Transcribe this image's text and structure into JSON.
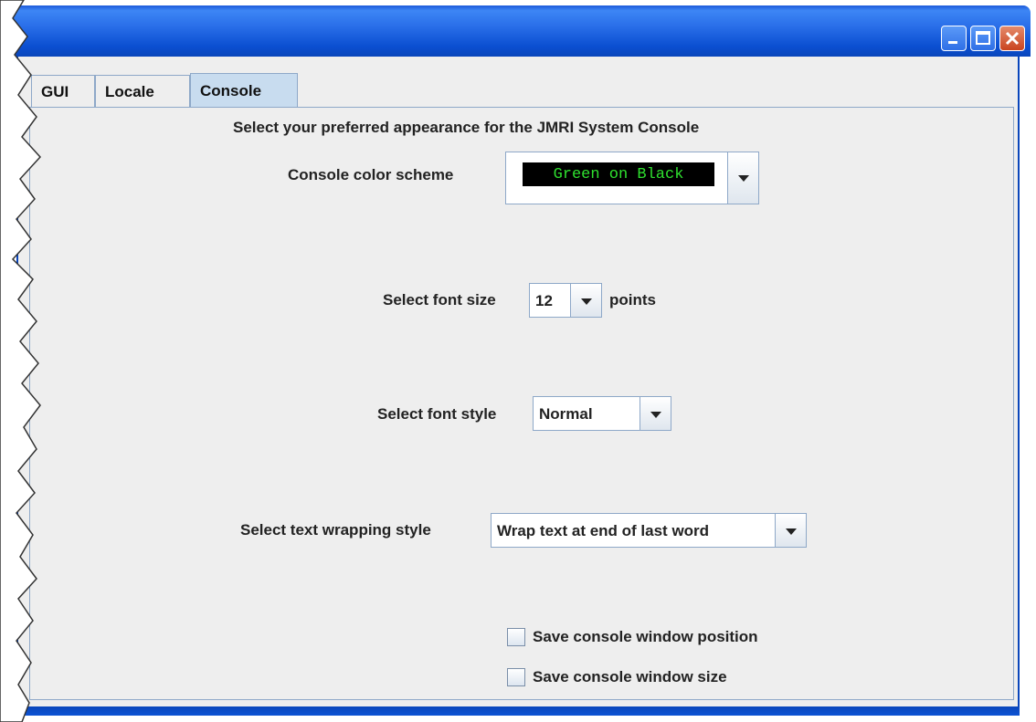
{
  "window": {
    "title": "",
    "controls": [
      "minimize-icon",
      "maximize-icon",
      "close-icon"
    ],
    "colors": {
      "titlebar": "#0a46bb",
      "background": "#eeeeee"
    }
  },
  "tabs": [
    {
      "label": "GUI",
      "active": false
    },
    {
      "label": "Locale",
      "active": false
    },
    {
      "label": "Console",
      "active": true
    }
  ],
  "console": {
    "heading": "Select your preferred appearance for the JMRI System Console",
    "color_scheme": {
      "label": "Console color scheme",
      "value": "Green on Black",
      "colors": {
        "foreground": "#2fe02f",
        "background": "#000000"
      }
    },
    "font_size": {
      "label": "Select font size",
      "value": "12",
      "unit": "points"
    },
    "font_style": {
      "label": "Select font style",
      "value": "Normal"
    },
    "wrap_style": {
      "label": "Select text wrapping style",
      "value": "Wrap text at end of last word"
    },
    "options": [
      {
        "label": "Save console window position",
        "checked": false
      },
      {
        "label": "Save console window size",
        "checked": false
      }
    ]
  }
}
